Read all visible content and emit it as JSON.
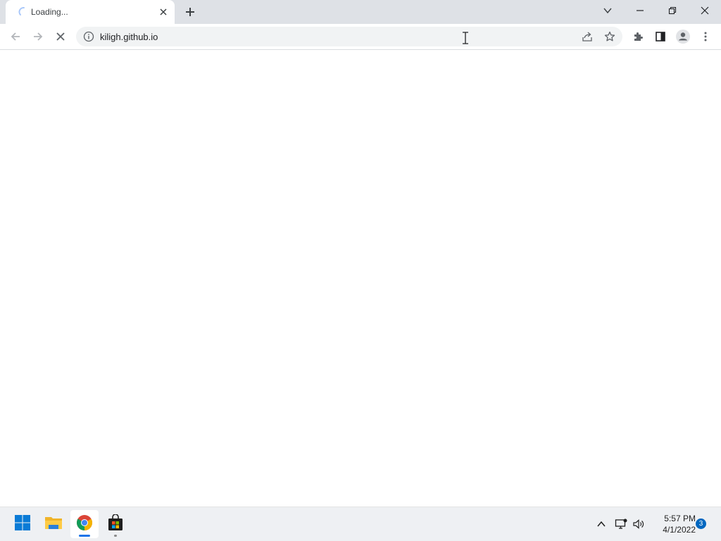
{
  "browser": {
    "tab": {
      "title": "Loading...",
      "loading": true,
      "close_icon": "close-icon"
    },
    "new_tab_icon": "plus-icon",
    "window_controls": [
      "chevron-down-icon",
      "minimize-icon",
      "restore-icon",
      "close-icon"
    ],
    "toolbar": {
      "back_icon": "arrow-left-icon",
      "forward_icon": "arrow-right-icon",
      "stop_icon": "close-icon",
      "address": "kiligh.github.io",
      "site_info_icon": "info-icon",
      "share_icon": "share-icon",
      "bookmark_icon": "star-icon",
      "extensions_icon": "puzzle-icon",
      "side_panel_icon": "side-panel-icon",
      "profile_icon": "profile-icon",
      "menu_icon": "kebab-menu-icon"
    }
  },
  "taskbar": {
    "apps": [
      {
        "name": "start",
        "icon": "windows-logo-icon"
      },
      {
        "name": "file-explorer",
        "icon": "folder-icon"
      },
      {
        "name": "chrome",
        "icon": "chrome-icon",
        "active": true
      },
      {
        "name": "microsoft-store",
        "icon": "store-icon"
      }
    ],
    "tray": {
      "overflow_icon": "chevron-up-icon",
      "network_icon": "network-icon",
      "volume_icon": "speaker-icon"
    },
    "clock": {
      "time": "5:57 PM",
      "date": "4/1/2022"
    },
    "notification_count": "3"
  },
  "colors": {
    "titlebar": "#dee1e6",
    "omnibox": "#f1f3f4",
    "taskbar": "#eef0f3",
    "accent": "#1a73e8",
    "badge": "#0067c0"
  }
}
